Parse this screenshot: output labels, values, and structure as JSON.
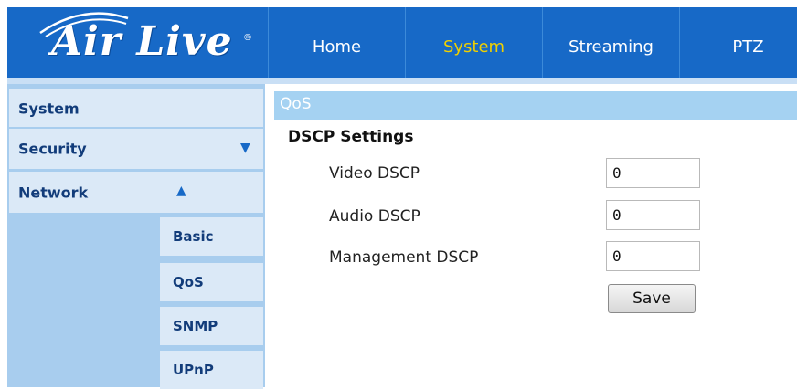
{
  "brand": {
    "logo_text": "Air Live",
    "registered_mark": "®"
  },
  "nav": {
    "tabs": [
      "Home",
      "System",
      "Streaming",
      "PTZ"
    ],
    "active": "System"
  },
  "sidebar": {
    "items": [
      {
        "label": "System"
      },
      {
        "label": "Security",
        "expanded": false
      },
      {
        "label": "Network",
        "expanded": true
      }
    ],
    "network_sub": [
      "Basic",
      "QoS",
      "SNMP",
      "UPnP"
    ]
  },
  "section": {
    "title": "QoS",
    "heading": "DSCP Settings"
  },
  "fields": [
    {
      "label": "Video DSCP",
      "value": "0"
    },
    {
      "label": "Audio DSCP",
      "value": "0"
    },
    {
      "label": "Management DSCP",
      "value": "0"
    }
  ],
  "save_label": "Save",
  "colors": {
    "header_blue": "#1769c7",
    "active_tab": "#f0d000",
    "sidebar_bg": "#a8cdee",
    "section_bar": "#a5d2f2"
  }
}
